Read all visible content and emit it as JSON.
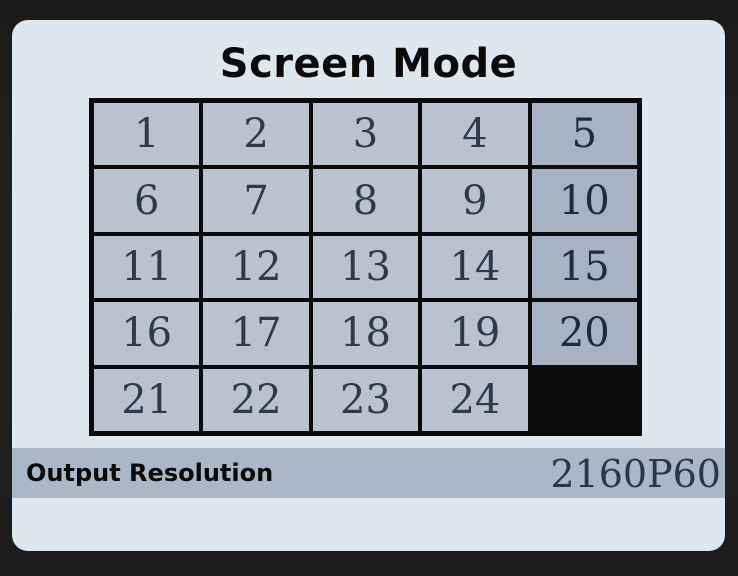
{
  "header": {
    "title": "Screen Mode"
  },
  "mode_grid": {
    "cells": [
      "1",
      "2",
      "3",
      "4",
      "5",
      "6",
      "7",
      "8",
      "9",
      "10",
      "11",
      "12",
      "13",
      "14",
      "15",
      "16",
      "17",
      "18",
      "19",
      "20",
      "21",
      "22",
      "23",
      "24"
    ]
  },
  "status_bar": {
    "label": "Output Resolution",
    "value": "2160P60"
  },
  "colors": {
    "screen_background": "#dde7ee",
    "cell_background": "#b9c3cf",
    "grid_lines": "#0a0a0a",
    "status_bar_background": "#a9b8c6"
  }
}
